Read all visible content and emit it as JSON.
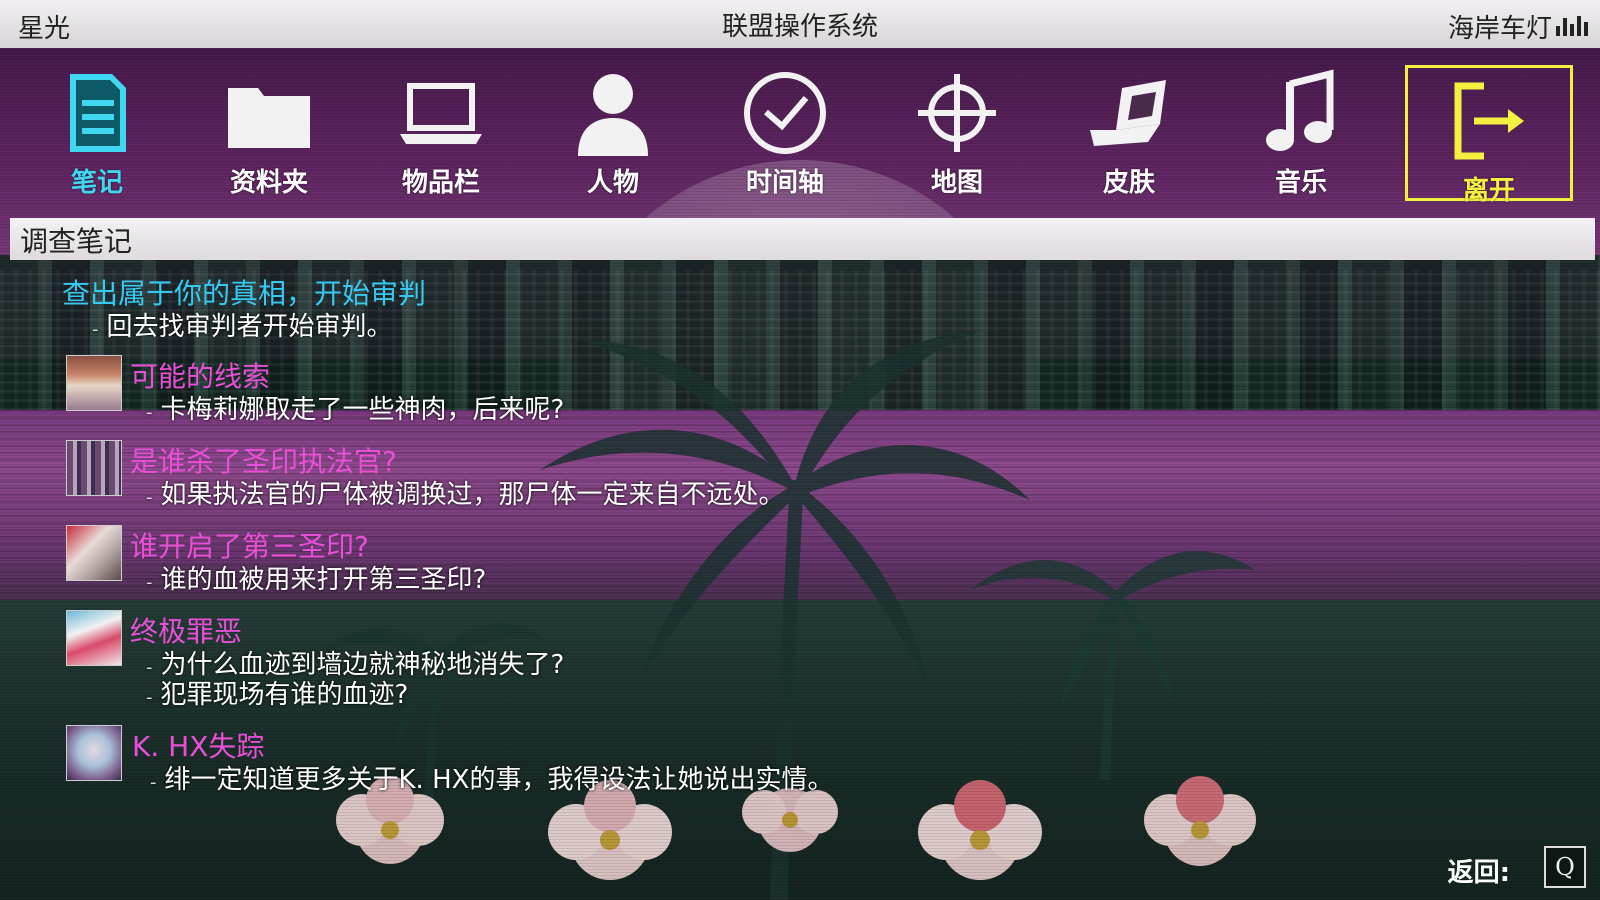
{
  "topbar": {
    "left": "星光",
    "title": "联盟操作系统",
    "right": "海岸车灯",
    "signal_icon": "signal-bars-icon"
  },
  "nav": {
    "items": [
      {
        "label": "笔记",
        "icon": "notes-icon",
        "state": "active"
      },
      {
        "label": "资料夹",
        "icon": "folder-icon"
      },
      {
        "label": "物品栏",
        "icon": "laptop-icon"
      },
      {
        "label": "人物",
        "icon": "person-icon"
      },
      {
        "label": "时间轴",
        "icon": "clock-icon"
      },
      {
        "label": "地图",
        "icon": "crosshair-icon"
      },
      {
        "label": "皮肤",
        "icon": "laptop-open-icon"
      },
      {
        "label": "音乐",
        "icon": "music-note-icon"
      },
      {
        "label": "离开",
        "icon": "exit-icon",
        "state": "highlighted"
      }
    ]
  },
  "section": {
    "title": "调查笔记"
  },
  "notes": [
    {
      "title": "查出属于你的真相，开始审判",
      "lines": [
        "回去找审判者开始审判。"
      ]
    },
    {
      "title": "可能的线索",
      "lines": [
        "卡梅莉娜取走了一些神肉，后来呢?"
      ]
    },
    {
      "title": "是谁杀了圣印执法官?",
      "lines": [
        "如果执法官的尸体被调换过，那尸体一定来自不远处。"
      ]
    },
    {
      "title": "谁开启了第三圣印?",
      "lines": [
        "谁的血被用来打开第三圣印?"
      ]
    },
    {
      "title": "终极罪恶",
      "lines": [
        "为什么血迹到墙边就神秘地消失了?",
        "犯罪现场有谁的血迹?"
      ]
    },
    {
      "title": "K. HX失踪",
      "lines": [
        "绯一定知道更多关于K. HX的事，我得设法让她说出实情。"
      ]
    }
  ],
  "footer": {
    "back_label": "返回:",
    "back_key": "Q"
  },
  "colors": {
    "active": "#3fd8f0",
    "highlight": "#f4f040",
    "note_title": "#e84fd6",
    "main_title": "#35c8f0"
  }
}
